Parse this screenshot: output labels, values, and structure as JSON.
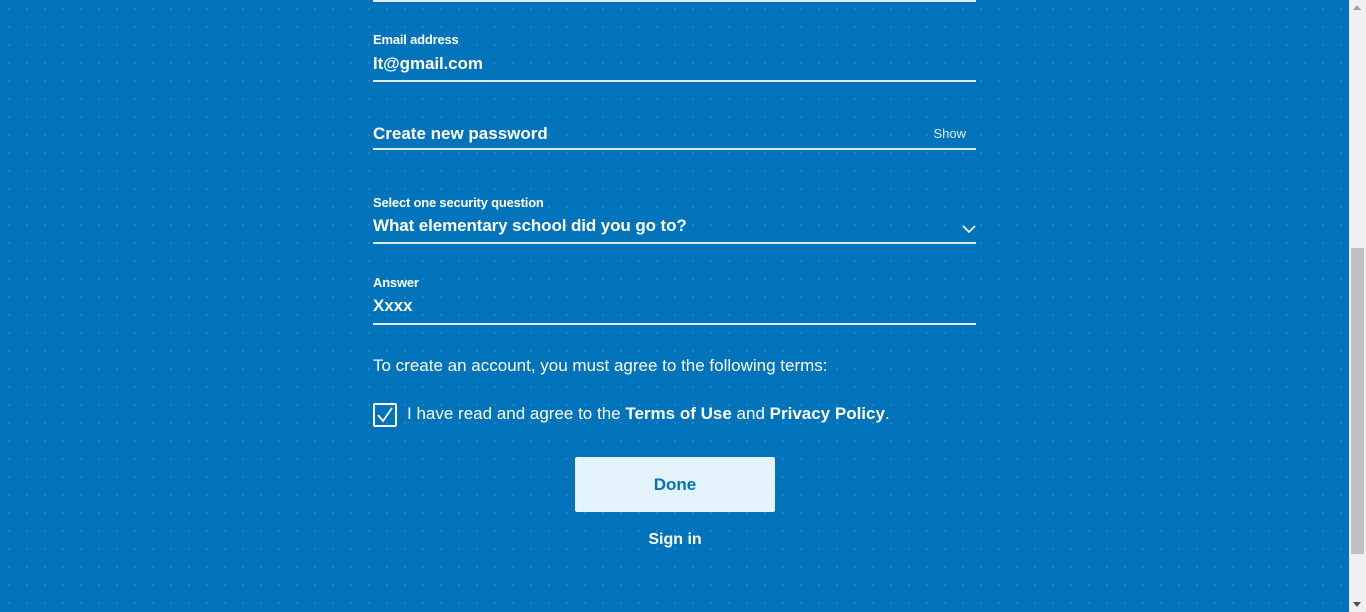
{
  "form": {
    "email": {
      "label": "Email address",
      "value": "lt@gmail.com"
    },
    "password": {
      "placeholder": "Create new password",
      "show_label": "Show"
    },
    "security_question": {
      "label": "Select one security question",
      "selected": "What elementary school did you go to?"
    },
    "answer": {
      "label": "Answer",
      "value": "Xxxx"
    },
    "terms": {
      "intro": "To create an account, you must agree to the following terms:",
      "checked": true,
      "agree_prefix": "I have read and agree to the",
      "terms_link": "Terms of Use",
      "conjunction": "and",
      "privacy_link": "Privacy Policy",
      "suffix": "."
    },
    "done_label": "Done",
    "sign_in_label": "Sign in"
  },
  "colors": {
    "background": "#0073bb",
    "button_bg": "#e3f2fb",
    "button_text": "#0073bb",
    "underline": "#d9ecf8"
  },
  "icons": {
    "checkbox": "checkmark-icon",
    "dropdown": "chevron-down-icon"
  }
}
